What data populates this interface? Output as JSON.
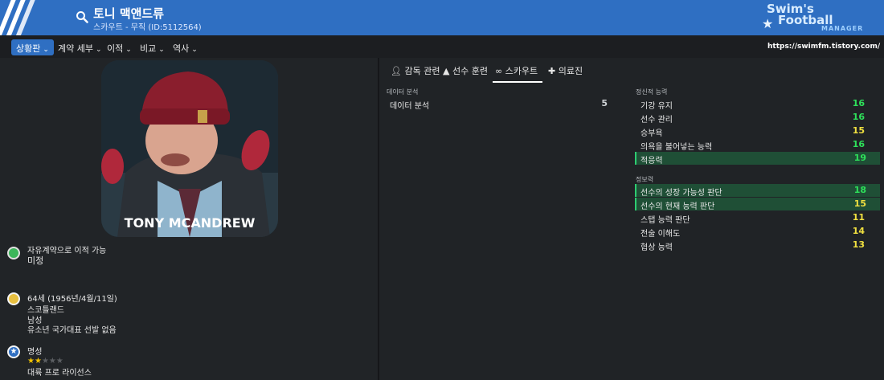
{
  "header": {
    "title": "토니 맥앤드류",
    "subtitle": "스카우트 - 무직 (ID:5112564)",
    "logo": {
      "line1": "Swim's",
      "line2": "Football",
      "line3": "MANAGER"
    },
    "url": "https://swimfm.tistory.com/"
  },
  "nav": {
    "items": [
      "상황판",
      "계약 세부",
      "이적",
      "비교",
      "역사"
    ]
  },
  "portrait": {
    "name": "TONY MCANDREW"
  },
  "info": {
    "transfer_label": "자유계약으로 이적 가능",
    "transfer_value": "미정",
    "transfer_icon": "green-circle-icon",
    "age_line": "64세 (1956년/4월/11일)",
    "nation": "스코틀랜드",
    "gender": "남성",
    "youth_caps": "유소년 국가대표 선발 없음",
    "reputation_label": "명성",
    "reputation_stars": 2,
    "reputation_max": 5,
    "license": "대륙 프로 라이선스"
  },
  "tabs": [
    "감독 관련",
    "선수 훈련",
    "스카우트",
    "의료진"
  ],
  "data_analysis": {
    "section": "데이터 분석",
    "rows": [
      {
        "name": "데이터 분석",
        "value": "5"
      }
    ]
  },
  "mental": {
    "section": "정신적 능력",
    "rows": [
      {
        "name": "기강 유지",
        "value": "16"
      },
      {
        "name": "선수 관리",
        "value": "16"
      },
      {
        "name": "승부욕",
        "value": "15"
      },
      {
        "name": "의욕을 불어넣는 능력",
        "value": "16"
      },
      {
        "name": "적응력",
        "value": "19"
      }
    ]
  },
  "knowledge": {
    "section": "정보력",
    "rows": [
      {
        "name": "선수의 성장 가능성 판단",
        "value": "18"
      },
      {
        "name": "선수의 현재 능력 판단",
        "value": "15"
      },
      {
        "name": "스탭 능력 판단",
        "value": "11"
      },
      {
        "name": "전술 이해도",
        "value": "14"
      },
      {
        "name": "협상 능력",
        "value": "13"
      }
    ]
  },
  "colors": {
    "high": "#2ee05a",
    "mid": "#f0e040",
    "low": "#cfd3d6",
    "accent": "#2f6fc2"
  }
}
